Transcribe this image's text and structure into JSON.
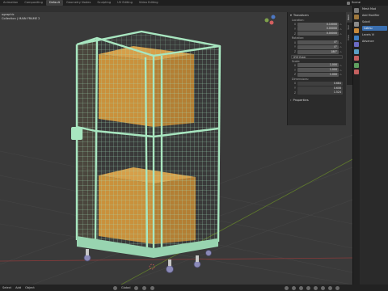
{
  "topbar": {
    "tabs": [
      "Animation",
      "Compositing",
      "Default",
      "Geometry Nodes",
      "Sculpting",
      "UV Editing",
      "Video Editing"
    ],
    "active_tab": "Default",
    "scene": "Scene"
  },
  "viewport": {
    "overlay_line1": "ographic",
    "overlay_line2": "Collection | MAIN FRAME 2"
  },
  "npanel": {
    "section_title": "Transform",
    "location_label": "Location:",
    "location": [
      {
        "axis": "X",
        "value": "0.10000"
      },
      {
        "axis": "Y",
        "value": "0.00000"
      },
      {
        "axis": "Z",
        "value": "0.00000"
      }
    ],
    "rotation_label": "Rotation:",
    "rotation": [
      {
        "axis": "X",
        "value": "0°"
      },
      {
        "axis": "Y",
        "value": "0°"
      },
      {
        "axis": "Z",
        "value": "180°"
      }
    ],
    "rotation_mode": "XYZ Euler",
    "scale_label": "Scale:",
    "scale": [
      {
        "axis": "X",
        "value": "1.000"
      },
      {
        "axis": "Y",
        "value": "1.000"
      },
      {
        "axis": "Z",
        "value": "1.000"
      }
    ],
    "dimensions_label": "Dimensions:",
    "dimensions": [
      {
        "axis": "X",
        "value": "0.684"
      },
      {
        "axis": "Y",
        "value": "0.608"
      },
      {
        "axis": "Z",
        "value": "1.524"
      }
    ],
    "properties_title": "Properties",
    "tabs": [
      "Item",
      "Tool",
      "View"
    ]
  },
  "properties": {
    "line1": "Mesh Mod",
    "line2": "Add Modifier",
    "item3": "Subdi",
    "btn1": "Catmu",
    "line5": "Levels Vi",
    "line6": "Advance"
  },
  "bottombar": {
    "left": [
      "Select",
      "Add",
      "Object"
    ],
    "mode": "Global"
  }
}
